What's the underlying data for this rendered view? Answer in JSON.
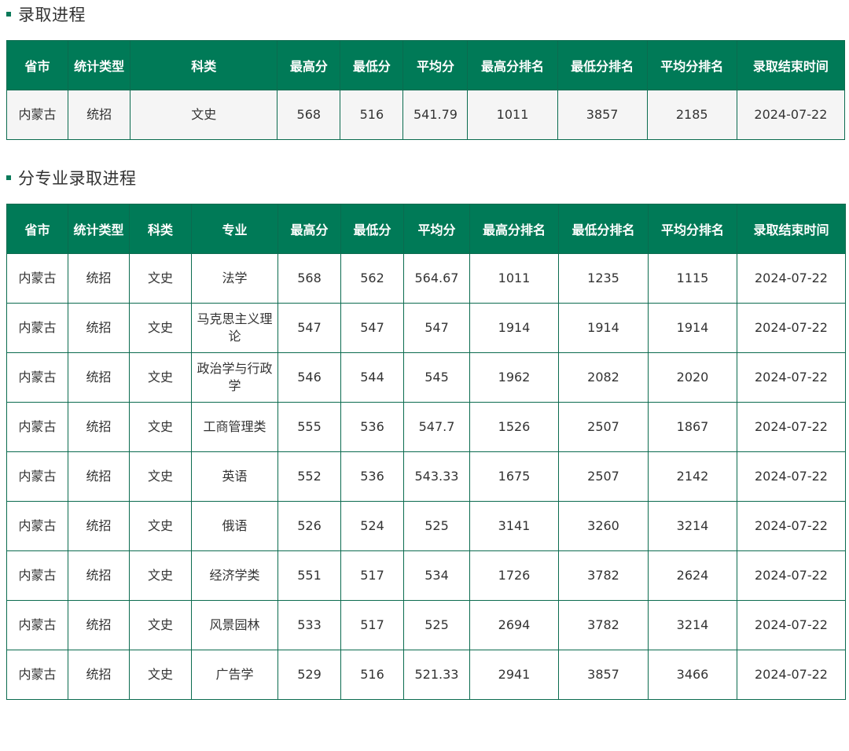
{
  "section1": {
    "title": "录取进程",
    "headers": [
      "省市",
      "统计类型",
      "科类",
      "最高分",
      "最低分",
      "平均分",
      "最高分排名",
      "最低分排名",
      "平均分排名",
      "录取结束时间"
    ],
    "rows": [
      [
        "内蒙古",
        "统招",
        "文史",
        "568",
        "516",
        "541.79",
        "1011",
        "3857",
        "2185",
        "2024-07-22"
      ]
    ]
  },
  "section2": {
    "title": "分专业录取进程",
    "headers": [
      "省市",
      "统计类型",
      "科类",
      "专业",
      "最高分",
      "最低分",
      "平均分",
      "最高分排名",
      "最低分排名",
      "平均分排名",
      "录取结束时间"
    ],
    "rows": [
      [
        "内蒙古",
        "统招",
        "文史",
        "法学",
        "568",
        "562",
        "564.67",
        "1011",
        "1235",
        "1115",
        "2024-07-22"
      ],
      [
        "内蒙古",
        "统招",
        "文史",
        "马克思主义理论",
        "547",
        "547",
        "547",
        "1914",
        "1914",
        "1914",
        "2024-07-22"
      ],
      [
        "内蒙古",
        "统招",
        "文史",
        "政治学与行政学",
        "546",
        "544",
        "545",
        "1962",
        "2082",
        "2020",
        "2024-07-22"
      ],
      [
        "内蒙古",
        "统招",
        "文史",
        "工商管理类",
        "555",
        "536",
        "547.7",
        "1526",
        "2507",
        "1867",
        "2024-07-22"
      ],
      [
        "内蒙古",
        "统招",
        "文史",
        "英语",
        "552",
        "536",
        "543.33",
        "1675",
        "2507",
        "2142",
        "2024-07-22"
      ],
      [
        "内蒙古",
        "统招",
        "文史",
        "俄语",
        "526",
        "524",
        "525",
        "3141",
        "3260",
        "3214",
        "2024-07-22"
      ],
      [
        "内蒙古",
        "统招",
        "文史",
        "经济学类",
        "551",
        "517",
        "534",
        "1726",
        "3782",
        "2624",
        "2024-07-22"
      ],
      [
        "内蒙古",
        "统招",
        "文史",
        "风景园林",
        "533",
        "517",
        "525",
        "2694",
        "3782",
        "3214",
        "2024-07-22"
      ],
      [
        "内蒙古",
        "统招",
        "文史",
        "广告学",
        "529",
        "516",
        "521.33",
        "2941",
        "3857",
        "3466",
        "2024-07-22"
      ]
    ]
  },
  "colors": {
    "header_bg": "#007a57",
    "border": "#0b6b4f",
    "marker": "#0a7a5a",
    "summary_row_bg": "#f5f5f5"
  }
}
